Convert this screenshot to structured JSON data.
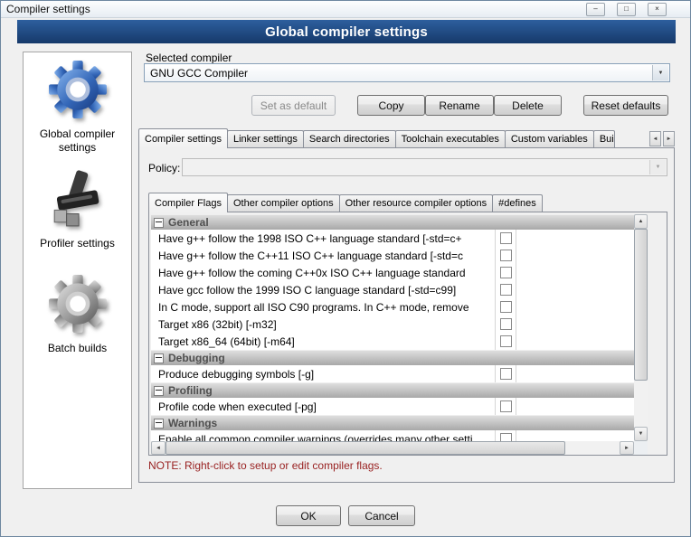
{
  "window": {
    "title": "Compiler settings",
    "header": "Global compiler settings"
  },
  "icons": {
    "minimize": "–",
    "maximize": "□",
    "close": "×",
    "dropdown": "▼",
    "arrow_up": "▲",
    "arrow_down": "▼",
    "arrow_left": "◄",
    "arrow_right": "►"
  },
  "colors": {
    "header_top": "#2d5f9e",
    "header_bottom": "#16396a",
    "note_color": "#992222",
    "category_text": "#4f4f4f"
  },
  "sidebar": {
    "items": [
      {
        "label": "Global compiler settings",
        "icon": "gear-blue"
      },
      {
        "label": "Profiler settings",
        "icon": "profiler-tool"
      },
      {
        "label": "Batch builds",
        "icon": "gear-gray"
      }
    ]
  },
  "compiler_select": {
    "label": "Selected compiler",
    "value": "GNU GCC Compiler"
  },
  "toolbar": {
    "set_default_label": "Set as default",
    "copy_label": "Copy",
    "rename_label": "Rename",
    "delete_label": "Delete",
    "reset_label": "Reset defaults"
  },
  "tabs": {
    "items": [
      "Compiler settings",
      "Linker settings",
      "Search directories",
      "Toolchain executables",
      "Custom variables",
      "Bui"
    ],
    "active": "Compiler settings"
  },
  "policy": {
    "label": "Policy:",
    "value": ""
  },
  "subtabs": {
    "items": [
      "Compiler Flags",
      "Other compiler options",
      "Other resource compiler options",
      "#defines"
    ],
    "active": "Compiler Flags"
  },
  "flags": {
    "groups": [
      {
        "name": "General",
        "options": [
          {
            "label": "Have g++ follow the 1998 ISO C++ language standard  [-std=c+",
            "checked": false
          },
          {
            "label": "Have g++ follow the C++11 ISO C++ language standard  [-std=c",
            "checked": false
          },
          {
            "label": "Have g++ follow the coming C++0x ISO C++ language standard",
            "checked": false
          },
          {
            "label": "Have gcc follow the 1999 ISO C language standard  [-std=c99]",
            "checked": false
          },
          {
            "label": "In C mode, support all ISO C90 programs. In C++ mode, remove",
            "checked": false
          },
          {
            "label": "Target x86 (32bit)  [-m32]",
            "checked": false
          },
          {
            "label": "Target x86_64 (64bit)  [-m64]",
            "checked": false
          }
        ]
      },
      {
        "name": "Debugging",
        "options": [
          {
            "label": "Produce debugging symbols  [-g]",
            "checked": false
          }
        ]
      },
      {
        "name": "Profiling",
        "options": [
          {
            "label": "Profile code when executed  [-pg]",
            "checked": false
          }
        ]
      },
      {
        "name": "Warnings",
        "options": [
          {
            "label": "Enable all common compiler warnings (overrides many other setti",
            "checked": false
          }
        ]
      }
    ]
  },
  "note": "NOTE: Right-click to setup or edit compiler flags.",
  "footer": {
    "ok_label": "OK",
    "cancel_label": "Cancel"
  }
}
